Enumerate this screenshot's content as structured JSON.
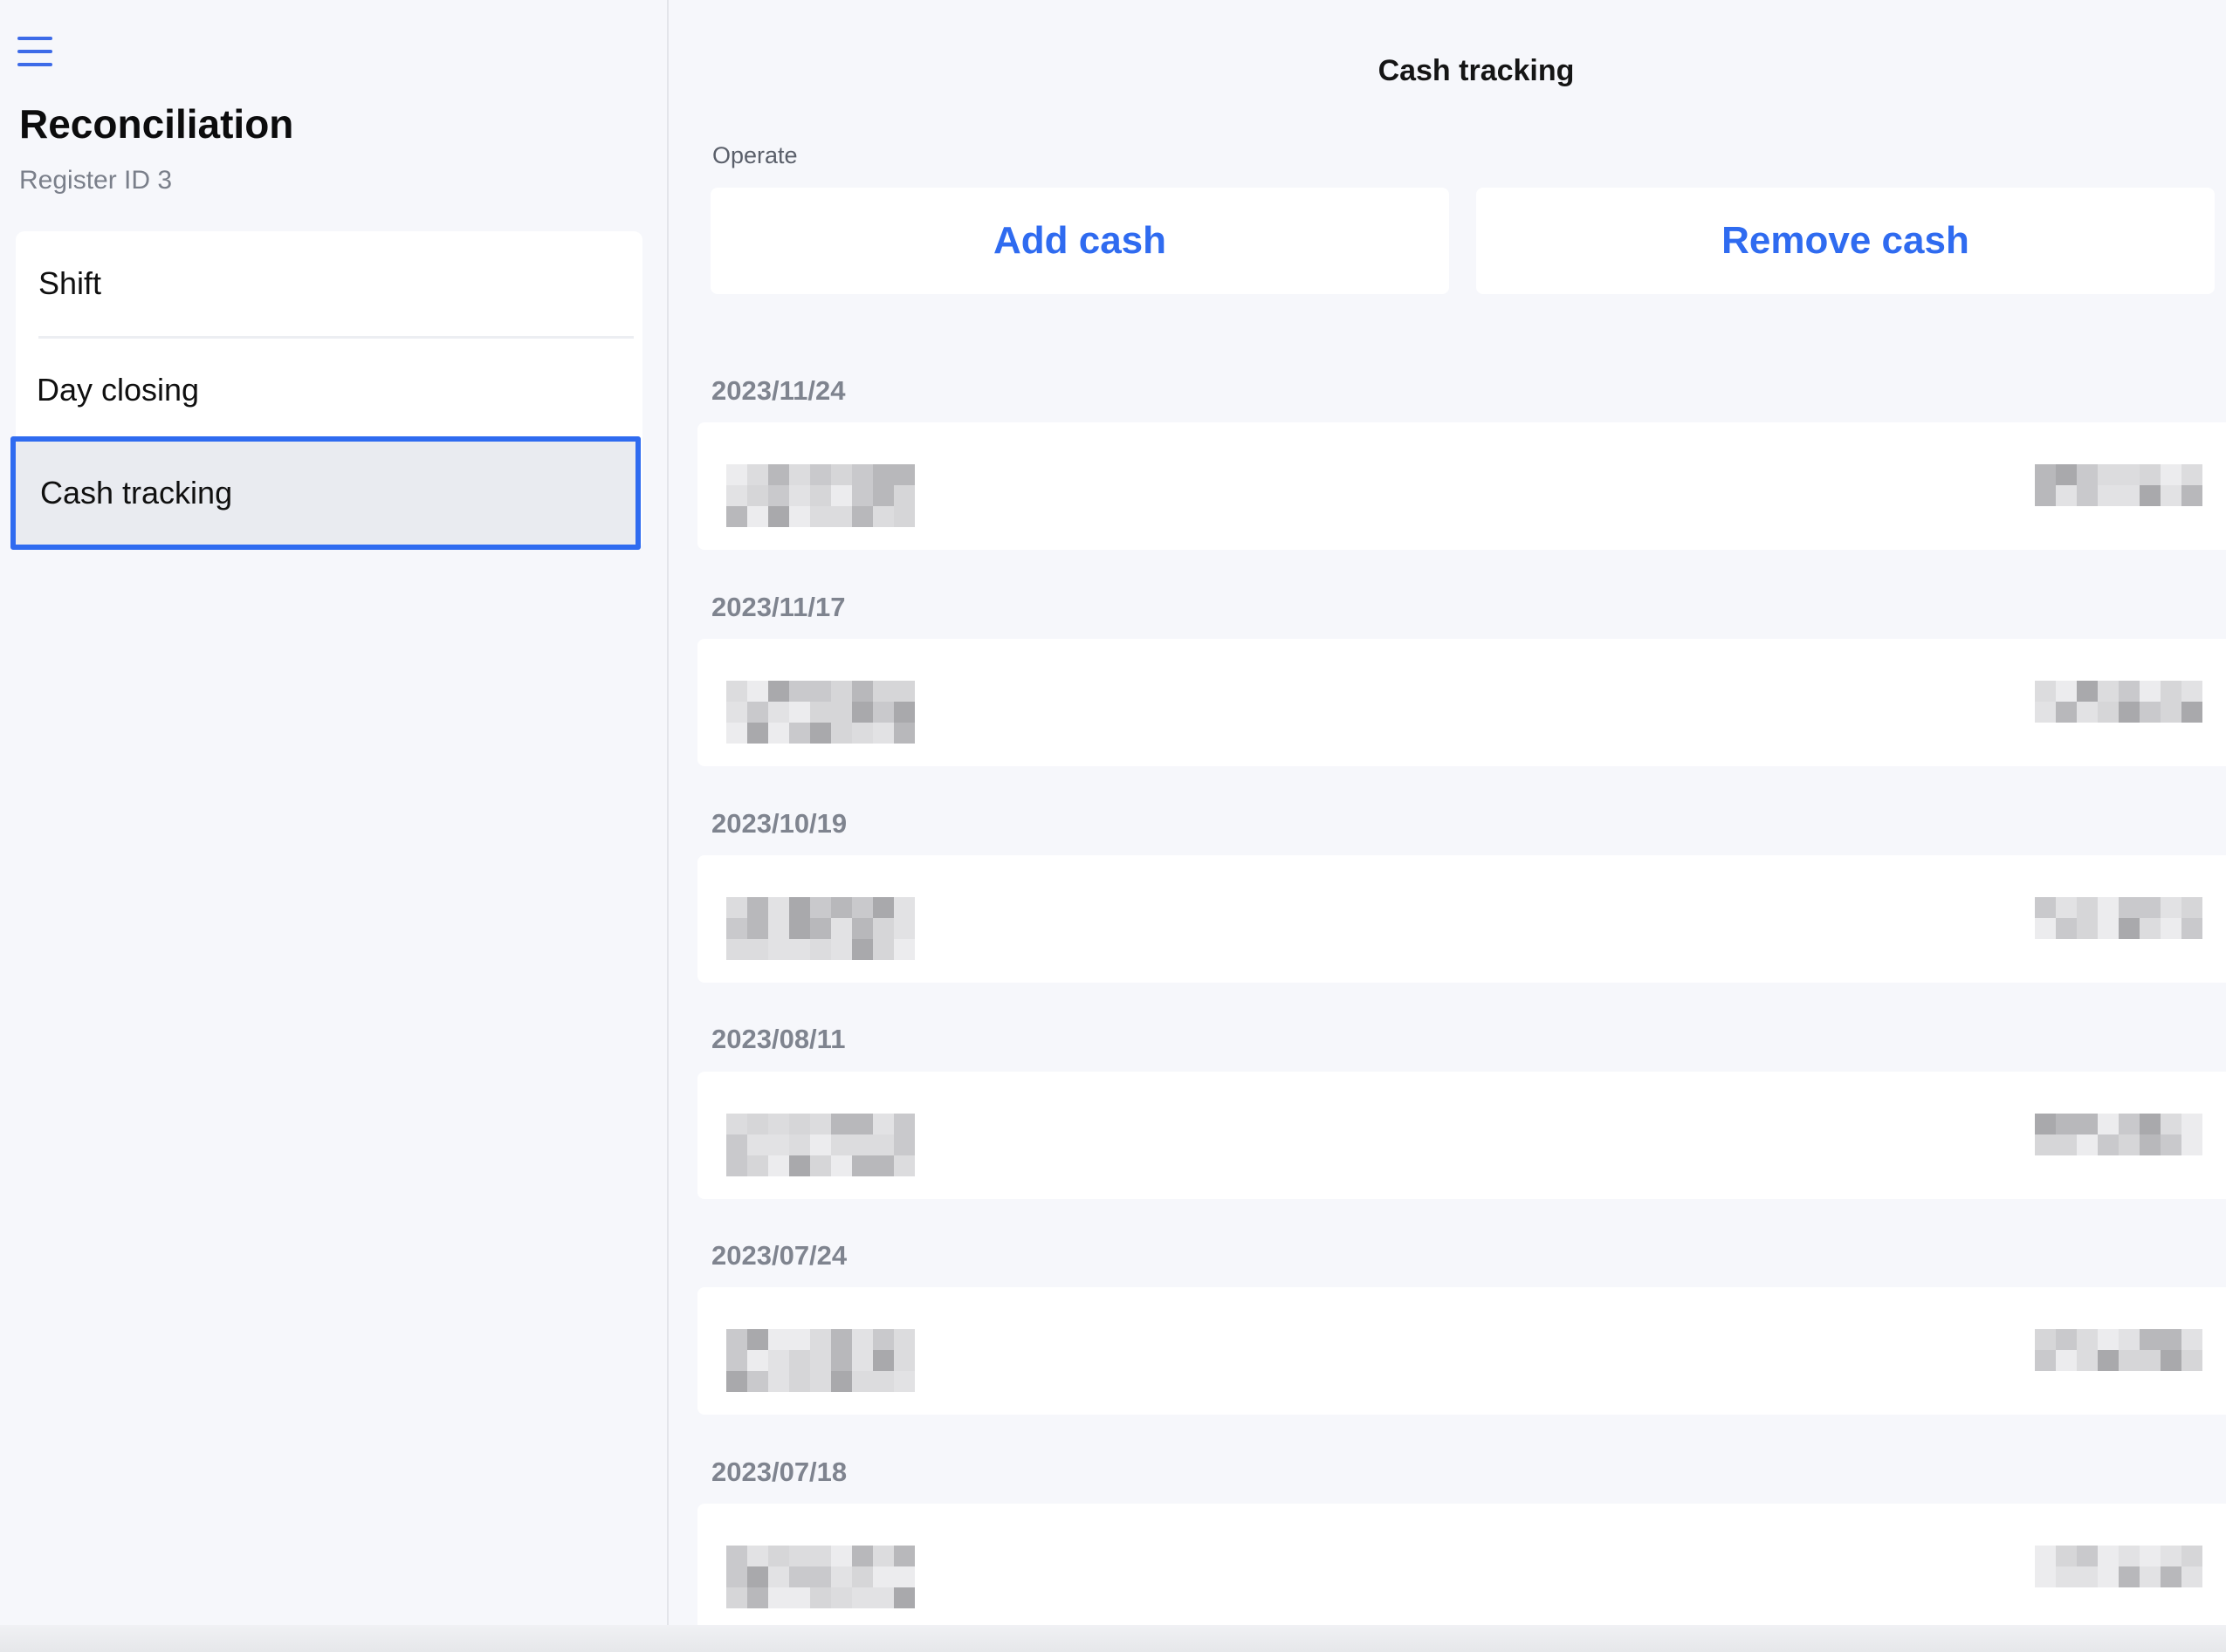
{
  "sidebar": {
    "menu_icon": "hamburger-menu-icon",
    "title": "Reconciliation",
    "subtitle": "Register ID 3",
    "items": [
      {
        "label": "Shift",
        "active": false
      },
      {
        "label": "Day closing",
        "active": false
      },
      {
        "label": "Cash tracking",
        "active": true
      }
    ]
  },
  "main": {
    "title": "Cash tracking",
    "operate_label": "Operate",
    "add_cash_label": "Add cash",
    "remove_cash_label": "Remove cash",
    "entries": [
      {
        "date": "2023/11/24"
      },
      {
        "date": "2023/11/17"
      },
      {
        "date": "2023/10/19"
      },
      {
        "date": "2023/08/11"
      },
      {
        "date": "2023/07/24"
      },
      {
        "date": "2023/07/18"
      }
    ]
  },
  "colors": {
    "accent": "#2f6bf0",
    "background": "#f6f7fb",
    "card": "#ffffff",
    "muted_text": "#7f848f"
  }
}
